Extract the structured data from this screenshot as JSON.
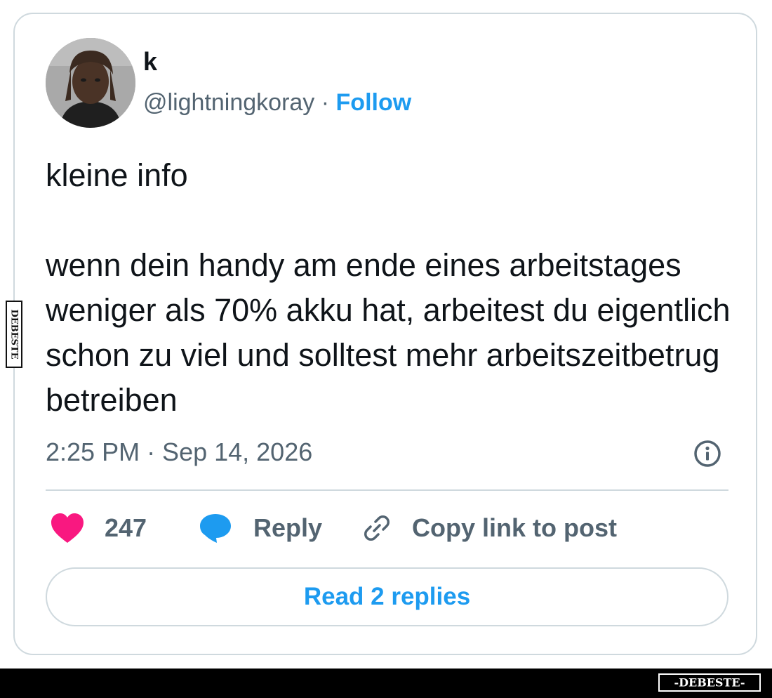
{
  "tweet": {
    "display_name": "k",
    "handle": "@lightningkoray",
    "separator": " · ",
    "follow_label": "Follow",
    "text": "kleine info\n\nwenn dein handy am ende eines arbeitstages weniger als 70% akku hat, arbeitest du eigentlich schon zu viel und solltest mehr arbeitszeitbetrug betreiben",
    "timestamp": "2:25 PM · Sep 14, 2026"
  },
  "actions": {
    "like_count": "247",
    "reply_label": "Reply",
    "copy_link_label": "Copy link to post"
  },
  "read_replies_label": "Read 2 replies",
  "watermark": {
    "text": "-DEBESTE-",
    "side_text": "DEBESTE"
  },
  "colors": {
    "accent": "#1d9bf0",
    "like": "#f91880",
    "muted": "#536471",
    "border": "#cfd9de",
    "text": "#0f1419"
  },
  "icons": {
    "info": "info-circle-icon",
    "like": "heart-icon",
    "reply": "speech-bubble-icon",
    "copy": "link-icon"
  }
}
